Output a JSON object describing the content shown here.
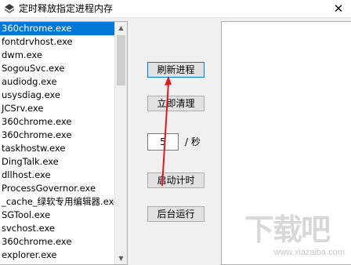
{
  "window": {
    "title": "定时释放指定进程内存",
    "close_glyph": "✕"
  },
  "process_list": {
    "items": [
      "360chrome.exe",
      "fontdrvhost.exe",
      "dwm.exe",
      "SogouSvc.exe",
      "audiodg.exe",
      "usysdiag.exe",
      "JCSrv.exe",
      "360chrome.exe",
      "360chrome.exe",
      "taskhostw.exe",
      "DingTalk.exe",
      "dllhost.exe",
      "ProcessGovernor.exe",
      "_cache_绿软专用编辑器.exe",
      "SGTool.exe",
      "svchost.exe",
      "360chrome.exe",
      "explorer.exe"
    ],
    "selected_index": 0,
    "scroll_up_glyph": "▲",
    "scroll_down_glyph": "▼"
  },
  "controls": {
    "refresh_label": "刷新进程",
    "clear_label": "立即清理",
    "interval_value": "5",
    "interval_unit": "/ 秒",
    "start_label": "启动计时",
    "background_label": "后台运行"
  },
  "watermark": {
    "text": "下载吧",
    "sub": "www.xiazaiba.com"
  },
  "colors": {
    "selection": "#0078d7",
    "arrow": "#e0191e"
  }
}
